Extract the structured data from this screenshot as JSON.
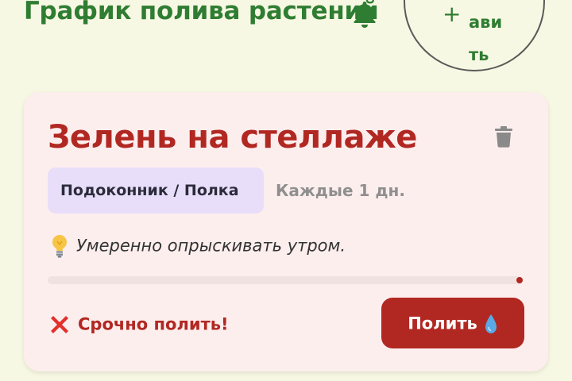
{
  "header": {
    "title": "График полива растений",
    "notification_icon": "bell-icon",
    "add_button": {
      "plus": "+",
      "label": "авить",
      "icon": "plus-icon"
    }
  },
  "card": {
    "title": "Зелень на стеллаже",
    "delete_icon": "trash-icon",
    "location": "Подоконник / Полка",
    "frequency": "Каждые 1 дн.",
    "tip": {
      "icon": "lightbulb-icon",
      "text": "Умеренно опрыскивать утром."
    },
    "progress": {
      "fraction": 0.0
    },
    "status": {
      "icon": "red-cross-icon",
      "text": "Срочно полить!"
    },
    "water_button": {
      "label": "Полить",
      "icon": "water-drop-icon"
    }
  },
  "colors": {
    "background": "#f7f8e3",
    "title_green": "#2f7d32",
    "card_background": "#fdeeee",
    "accent_red": "#b12822",
    "chip_lavender": "#e8defa",
    "muted_text": "#8f8f8f"
  }
}
